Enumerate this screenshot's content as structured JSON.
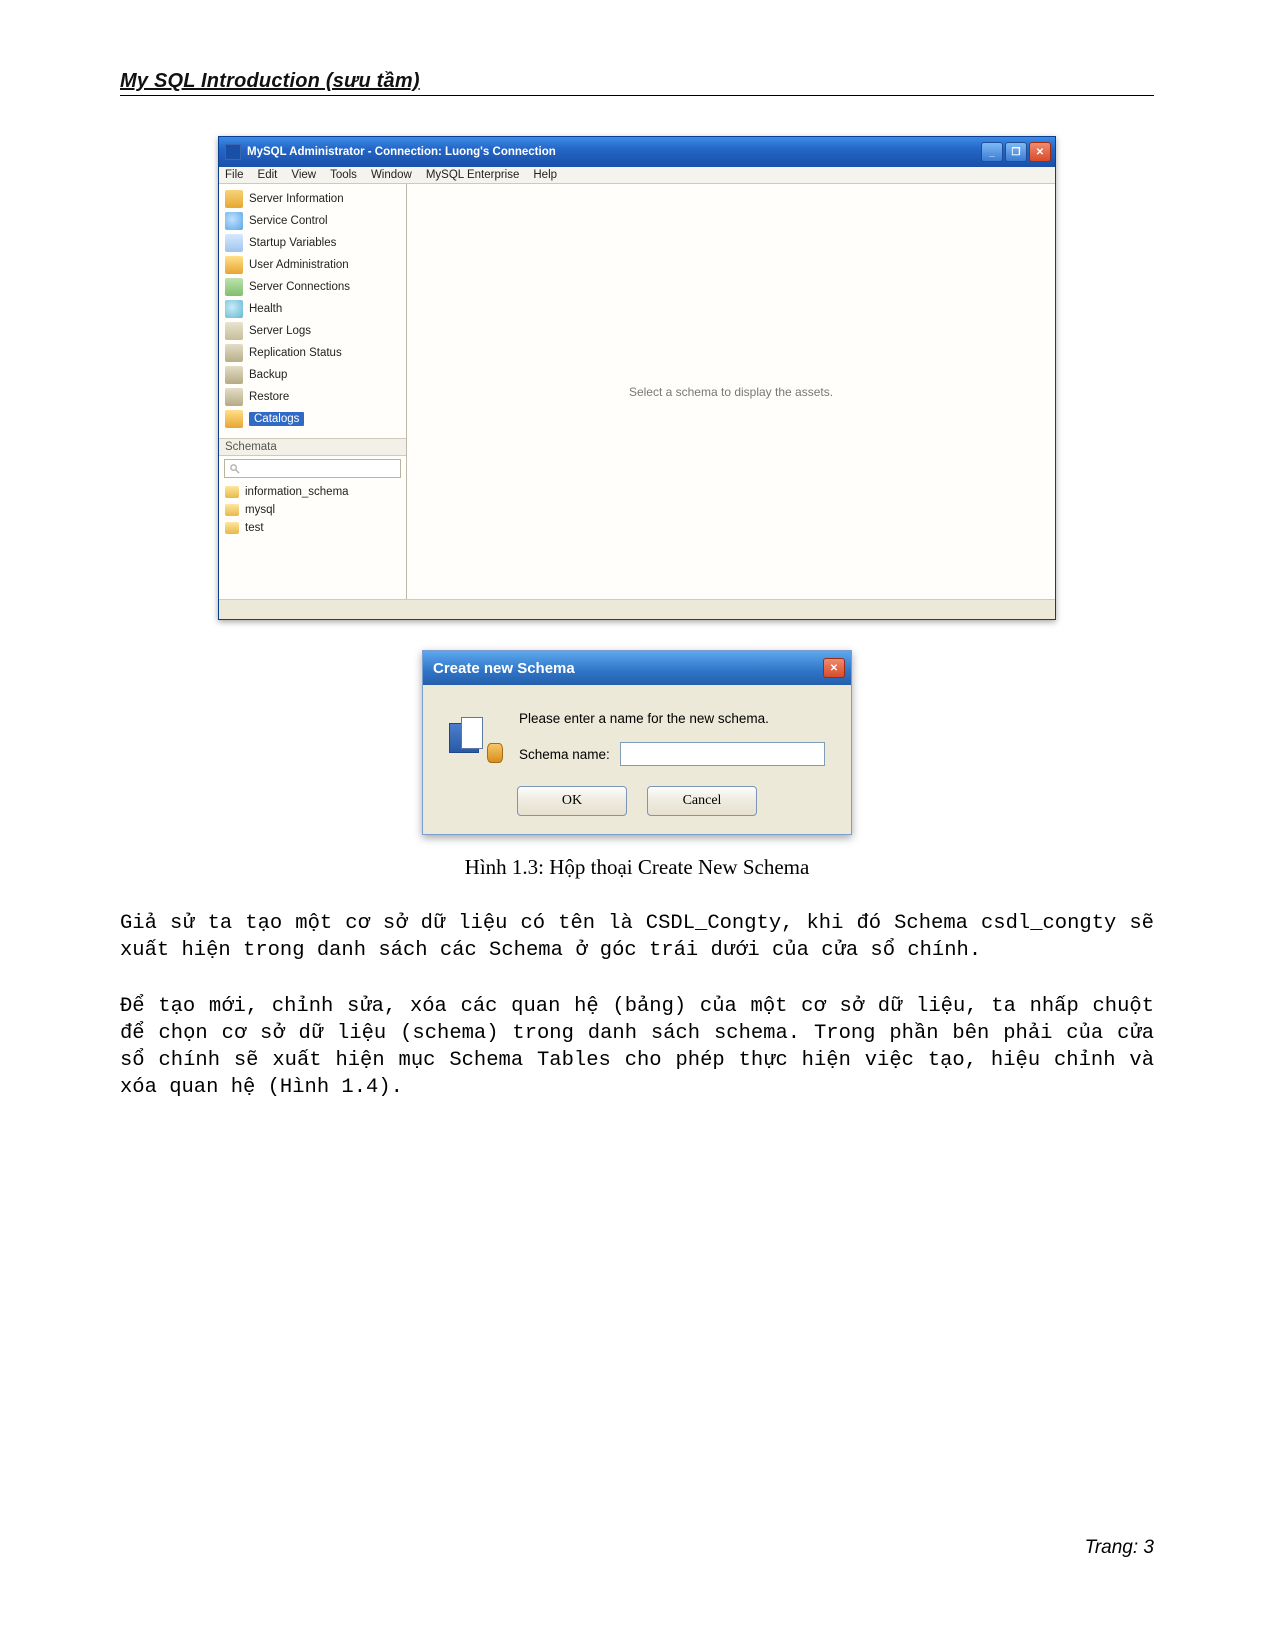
{
  "doc": {
    "header": "My SQL Introduction (sưu tầm)",
    "caption": "Hình 1.3: Hộp thoại Create New Schema",
    "para1": "Giả sử ta tạo một cơ sở dữ liệu có tên là CSDL_Congty, khi đó Schema csdl_congty sẽ xuất hiện trong danh sách các Schema ở góc trái dưới của cửa sổ chính.",
    "para2": "Để tạo mới, chỉnh sửa, xóa các quan hệ (bảng) của một cơ sở dữ liệu, ta nhấp chuột để chọn cơ sở dữ liệu (schema) trong danh sách schema. Trong phần bên phải của cửa sổ chính sẽ xuất hiện mục Schema Tables cho phép thực hiện việc tạo, hiệu chỉnh và xóa quan hệ (Hình 1.4).",
    "pagenum": "Trang: 3"
  },
  "admin": {
    "title": "MySQL Administrator - Connection: Luong's Connection",
    "menus": [
      "File",
      "Edit",
      "View",
      "Tools",
      "Window",
      "MySQL Enterprise",
      "Help"
    ],
    "nav": [
      {
        "label": "Server Information",
        "icon": "ico-server"
      },
      {
        "label": "Service Control",
        "icon": "ico-service"
      },
      {
        "label": "Startup Variables",
        "icon": "ico-startup"
      },
      {
        "label": "User Administration",
        "icon": "ico-user"
      },
      {
        "label": "Server Connections",
        "icon": "ico-conn"
      },
      {
        "label": "Health",
        "icon": "ico-health"
      },
      {
        "label": "Server Logs",
        "icon": "ico-logs"
      },
      {
        "label": "Replication Status",
        "icon": "ico-repl"
      },
      {
        "label": "Backup",
        "icon": "ico-backup"
      },
      {
        "label": "Restore",
        "icon": "ico-restore"
      },
      {
        "label": "Catalogs",
        "icon": "ico-catalogs",
        "selected": true
      }
    ],
    "schemata_header": "Schemata",
    "schemata": [
      "information_schema",
      "mysql",
      "test"
    ],
    "right_placeholder": "Select a schema to display the assets."
  },
  "dialog": {
    "title": "Create new Schema",
    "prompt": "Please enter a name for the new schema.",
    "label": "Schema name:",
    "value": "",
    "ok": "OK",
    "cancel": "Cancel"
  },
  "winctrl": {
    "min": "_",
    "max": "❐",
    "close": "✕",
    "dlgclose": "✕"
  }
}
